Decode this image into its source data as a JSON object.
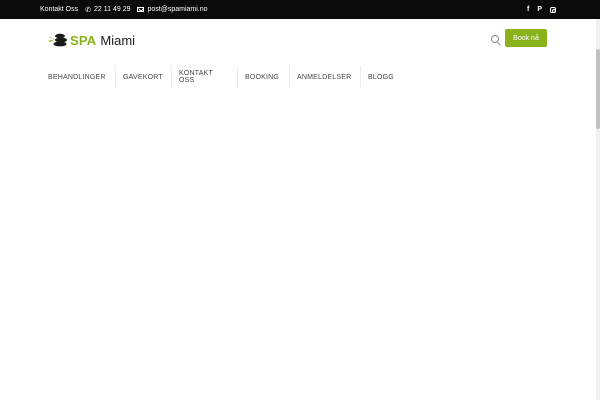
{
  "topbar": {
    "contact_label": "Kontakt Oss",
    "phone_icon": "phone-icon",
    "phone": "22 11 49 29",
    "email_icon": "mail-icon",
    "email": "post@spamiami.no",
    "social": {
      "facebook": "f",
      "pinterest": "P",
      "instagram_icon": "instagram-icon"
    }
  },
  "header": {
    "logo_spa": "SPA",
    "logo_miami": "Miami",
    "search_icon": "search-icon",
    "book_label": "Book nå"
  },
  "nav": {
    "items": [
      {
        "label": "BEHANDLINGER"
      },
      {
        "label": "GAVEKORT"
      },
      {
        "label": "KONTAKT OSS"
      },
      {
        "label": "BOOKING"
      },
      {
        "label": "ANMELDELSER"
      },
      {
        "label": "BLOGG"
      }
    ]
  },
  "colors": {
    "accent": "#8ab21b",
    "topbar_bg": "#0b0b0b",
    "text": "#444444"
  }
}
